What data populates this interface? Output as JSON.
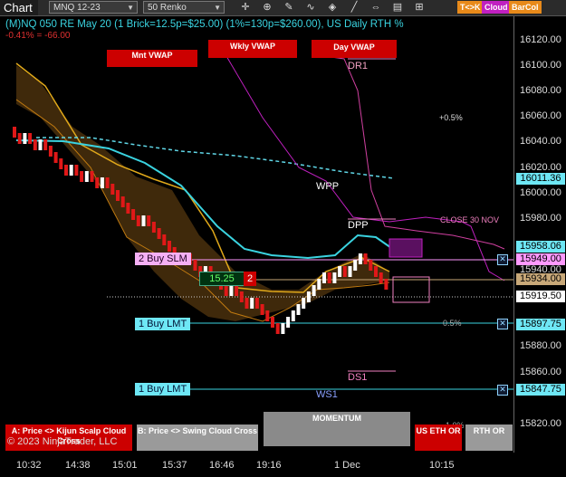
{
  "toolbar": {
    "tab": "Chart",
    "instrument": "MNQ 12-23",
    "bar_type": "50 Renko",
    "icons": [
      "crosshair-icon",
      "zoom-icon",
      "properties-icon",
      "indicators-icon",
      "strategies-icon",
      "drawing-icon",
      "scroll-icon",
      "data-box-icon",
      "grid-icon"
    ],
    "tags": [
      {
        "label": "T<>K",
        "color": "#e88a1a"
      },
      {
        "label": "Cloud",
        "color": "#c020c0"
      },
      {
        "label": "BarCol",
        "color": "#e88a1a"
      }
    ]
  },
  "chart": {
    "title": "(M)NQ 050 RE May 20 (1 Brick=12.5p=$25.00) (1%=130p=$260.00), US Daily RTH %",
    "performance": "-0.41% = -66.00",
    "copyright": "© 2023 NinjaTrader, LLC",
    "vwap_labels": {
      "monthly": "Mnt VWAP",
      "weekly": "Wkly VWAP",
      "daily": "Day VWAP"
    },
    "levels": {
      "dr1": "DR1",
      "wpp": "WPP",
      "dpp": "DPP",
      "ds1": "DS1",
      "ws1": "WS1",
      "close_30nov": "CLOSE 30 NOV",
      "pct_up": "+0.5%",
      "pct_down": "0.5%",
      "pct_low": "-1.0%"
    },
    "orders": [
      {
        "label": "2 Buy SLM",
        "price": "15949.00"
      },
      {
        "label": "1 Buy LMT",
        "price": "15897.75"
      },
      {
        "label": "1 Buy LMT",
        "price": "15847.75"
      }
    ],
    "position": {
      "avg_price": "15.25",
      "qty": "2"
    },
    "buttons": {
      "kijun": "A: Price <> Kijun Scalp Cloud Cross",
      "swing": "B: Price <> Swing Cloud Cross",
      "momentum": "MOMENTUM",
      "us_eth": "US ETH OR",
      "rth": "RTH OR"
    },
    "price_axis": {
      "ticks": [
        "16120.00",
        "16100.00",
        "16080.00",
        "16060.00",
        "16040.00",
        "16020.00",
        "16000.00",
        "15980.00",
        "15940.00",
        "15880.00",
        "15860.00",
        "15820.00"
      ],
      "markers": [
        {
          "value": "16011.36",
          "color": "#6ee7f5"
        },
        {
          "value": "15958.06",
          "color": "#6ee7f5"
        },
        {
          "value": "15949.00",
          "color": "#ff99ff"
        },
        {
          "value": "15934.00",
          "color": "#c8a878"
        },
        {
          "value": "15919.50",
          "color": "#ffffff"
        },
        {
          "value": "15897.75",
          "color": "#6ee7f5"
        },
        {
          "value": "15847.75",
          "color": "#6ee7f5"
        }
      ]
    },
    "time_axis": [
      "10:32",
      "14:38",
      "15:01",
      "15:37",
      "16:46",
      "19:16",
      "1 Dec",
      "10:15"
    ]
  }
}
